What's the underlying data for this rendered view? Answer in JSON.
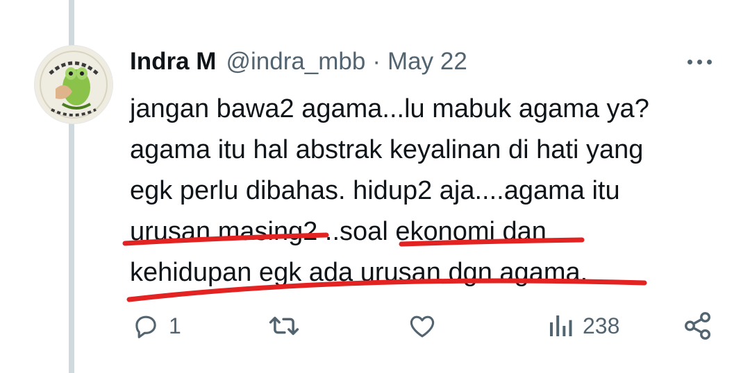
{
  "tweet": {
    "author_name": "Indra M",
    "handle": "@indra_mbb",
    "separator": "·",
    "date": "May 22",
    "lines": [
      "jangan bawa2 agama...lu mabuk agama ya?",
      "agama itu hal abstrak keyalinan di hati yang",
      "egk perlu dibahas. hidup2 aja....agama itu",
      "urusan masing2 ..soal ekonomi dan",
      "kehidupan egk ada urusan dgn agama."
    ],
    "annotation_color": "#e32222"
  },
  "actions": {
    "reply": {
      "icon": "reply-icon",
      "count": "1"
    },
    "retweet": {
      "icon": "retweet-icon"
    },
    "like": {
      "icon": "like-icon"
    },
    "views": {
      "icon": "views-icon",
      "count": "238"
    },
    "share": {
      "icon": "share-icon"
    }
  },
  "more_menu": {
    "icon": "more-options-icon"
  }
}
